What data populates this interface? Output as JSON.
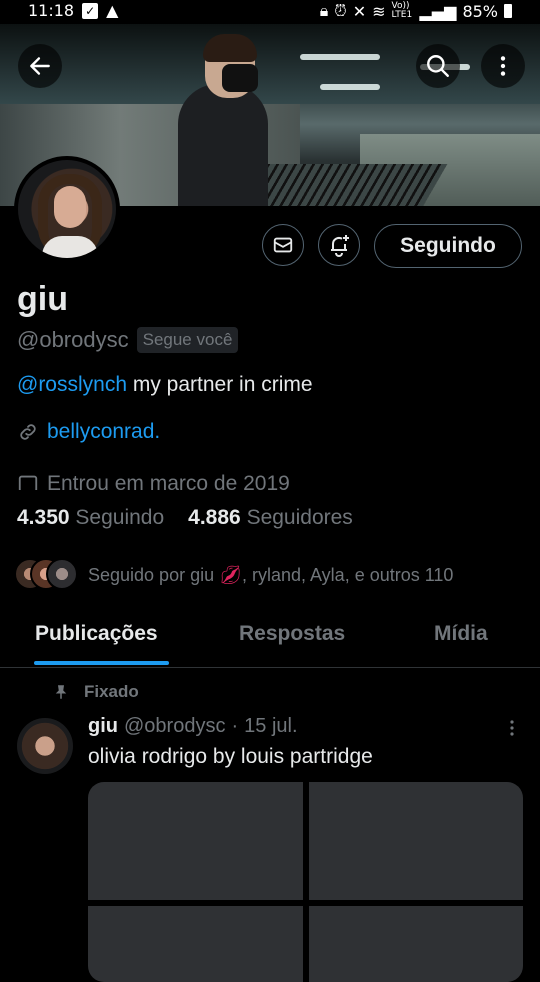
{
  "status_bar": {
    "time": "11:18",
    "volte": "Vo)) LTE1",
    "battery": "85%"
  },
  "profile": {
    "name": "giu",
    "handle": "@obrodysc",
    "follows_you_badge": "Segue você",
    "bio_mention": "@rosslynch",
    "bio_text": " my partner in crime",
    "link": "bellyconrad.",
    "joined": "Entrou em março de 2019",
    "following_count": "4.350",
    "following_label": "Seguindo",
    "followers_count": "4.886",
    "followers_label": "Seguidores",
    "followed_by_prefix": "Seguido por giu ",
    "followed_by_rest": ", ryland, Ayla, e outros 110"
  },
  "actions": {
    "follow_button": "Seguindo"
  },
  "tabs": [
    {
      "label": "Publicações",
      "active": true
    },
    {
      "label": "Respostas",
      "active": false
    },
    {
      "label": "Mídia",
      "active": false
    }
  ],
  "pinned_post": {
    "pinned_label": "Fixado",
    "author_name": "giu",
    "author_handle": "@obrodysc",
    "separator": "·",
    "date": "15 jul.",
    "text": "olivia rodrigo by louis partridge"
  },
  "colors": {
    "accent": "#1d9bf0",
    "background": "#000000",
    "muted": "#71767b",
    "text": "#e7e9ea"
  },
  "icons": [
    "back-arrow-icon",
    "search-icon",
    "more-vertical-icon",
    "mail-icon",
    "bell-plus-icon",
    "link-icon",
    "calendar-icon",
    "pin-icon",
    "kiss-emoji-icon"
  ]
}
